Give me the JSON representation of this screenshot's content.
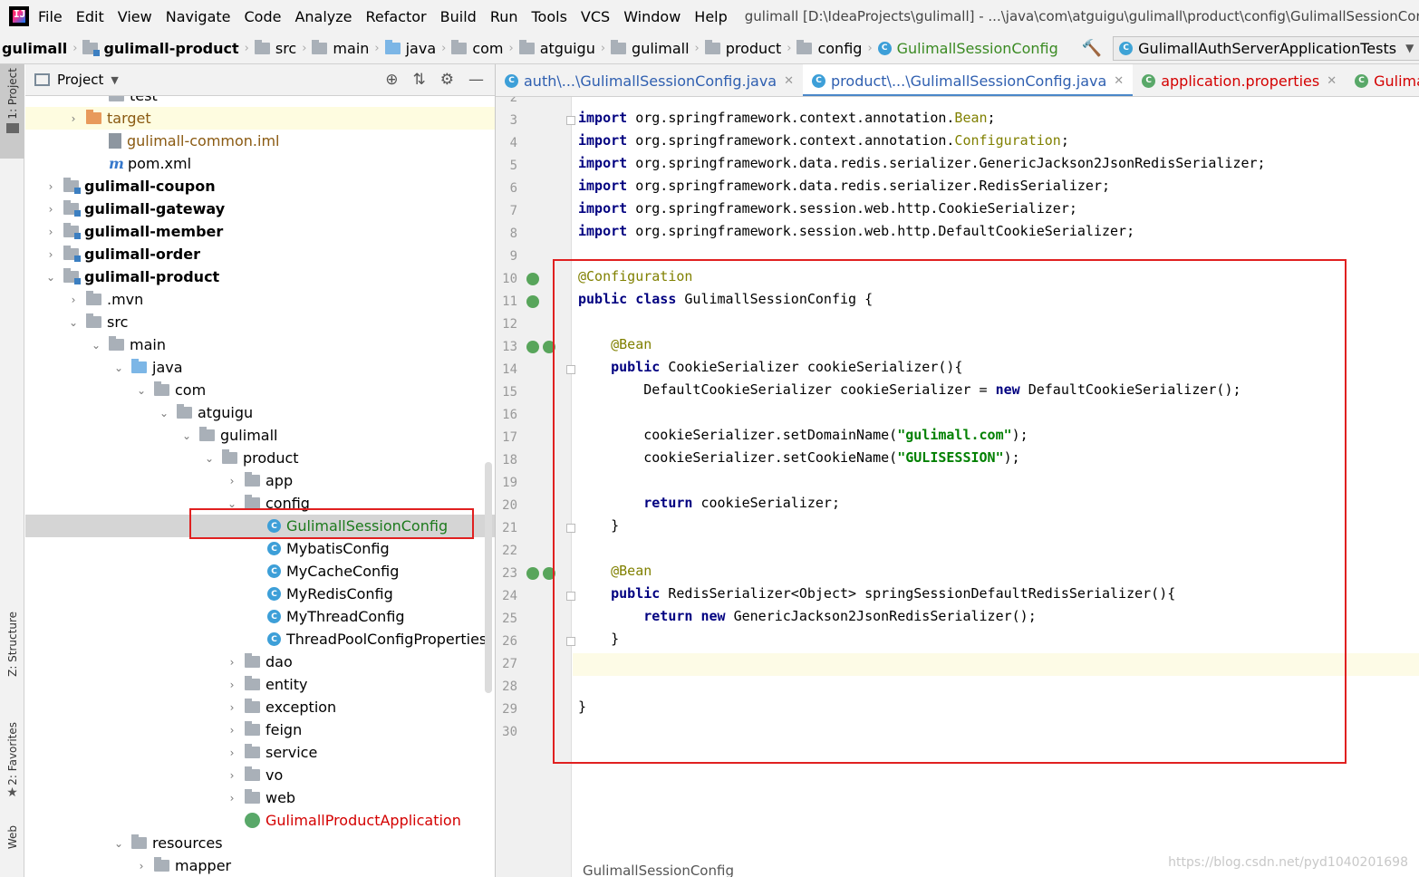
{
  "menubar": {
    "items": [
      "File",
      "Edit",
      "View",
      "Navigate",
      "Code",
      "Analyze",
      "Refactor",
      "Build",
      "Run",
      "Tools",
      "VCS",
      "Window",
      "Help"
    ],
    "window_title": "gulimall [D:\\IdeaProjects\\gulimall] - ...\\java\\com\\atguigu\\gulimall\\product\\config\\GulimallSessionConfig.java"
  },
  "breadcrumbs": [
    "gulimall",
    "gulimall-product",
    "src",
    "main",
    "java",
    "com",
    "atguigu",
    "gulimall",
    "product",
    "config",
    "GulimallSessionConfig"
  ],
  "run_config": "GulimallAuthServerApplicationTests",
  "left_strip": {
    "project": "1: Project",
    "structure": "Z: Structure",
    "favorites": "2: Favorites",
    "web": "Web"
  },
  "project_panel": {
    "title": "Project"
  },
  "tree": [
    {
      "label": "test",
      "indent": 3,
      "arrow": "",
      "icon": "folder",
      "style": ""
    },
    {
      "label": "target",
      "indent": 2,
      "arrow": "›",
      "icon": "folder-orange",
      "style": "brown",
      "highlight": true
    },
    {
      "label": "gulimall-common.iml",
      "indent": 3,
      "arrow": "",
      "icon": "file",
      "style": "brown"
    },
    {
      "label": "pom.xml",
      "indent": 3,
      "arrow": "",
      "icon": "maven",
      "style": ""
    },
    {
      "label": "gulimall-coupon",
      "indent": 1,
      "arrow": "›",
      "icon": "module",
      "style": "bold"
    },
    {
      "label": "gulimall-gateway",
      "indent": 1,
      "arrow": "›",
      "icon": "module",
      "style": "bold"
    },
    {
      "label": "gulimall-member",
      "indent": 1,
      "arrow": "›",
      "icon": "module",
      "style": "bold"
    },
    {
      "label": "gulimall-order",
      "indent": 1,
      "arrow": "›",
      "icon": "module",
      "style": "bold"
    },
    {
      "label": "gulimall-product",
      "indent": 1,
      "arrow": "⌄",
      "icon": "module",
      "style": "bold"
    },
    {
      "label": ".mvn",
      "indent": 2,
      "arrow": "›",
      "icon": "folder",
      "style": ""
    },
    {
      "label": "src",
      "indent": 2,
      "arrow": "⌄",
      "icon": "folder",
      "style": ""
    },
    {
      "label": "main",
      "indent": 3,
      "arrow": "⌄",
      "icon": "folder",
      "style": ""
    },
    {
      "label": "java",
      "indent": 4,
      "arrow": "⌄",
      "icon": "folder-blue",
      "style": ""
    },
    {
      "label": "com",
      "indent": 5,
      "arrow": "⌄",
      "icon": "folder",
      "style": ""
    },
    {
      "label": "atguigu",
      "indent": 6,
      "arrow": "⌄",
      "icon": "folder",
      "style": ""
    },
    {
      "label": "gulimall",
      "indent": 7,
      "arrow": "⌄",
      "icon": "folder",
      "style": ""
    },
    {
      "label": "product",
      "indent": 8,
      "arrow": "⌄",
      "icon": "folder",
      "style": ""
    },
    {
      "label": "app",
      "indent": 9,
      "arrow": "›",
      "icon": "folder",
      "style": ""
    },
    {
      "label": "config",
      "indent": 9,
      "arrow": "⌄",
      "icon": "folder",
      "style": ""
    },
    {
      "label": "GulimallSessionConfig",
      "indent": 10,
      "arrow": "",
      "icon": "class",
      "style": "green",
      "selected": true
    },
    {
      "label": "MybatisConfig",
      "indent": 10,
      "arrow": "",
      "icon": "class",
      "style": ""
    },
    {
      "label": "MyCacheConfig",
      "indent": 10,
      "arrow": "",
      "icon": "class",
      "style": ""
    },
    {
      "label": "MyRedisConfig",
      "indent": 10,
      "arrow": "",
      "icon": "class",
      "style": ""
    },
    {
      "label": "MyThreadConfig",
      "indent": 10,
      "arrow": "",
      "icon": "class",
      "style": ""
    },
    {
      "label": "ThreadPoolConfigProperties",
      "indent": 10,
      "arrow": "",
      "icon": "class",
      "style": ""
    },
    {
      "label": "dao",
      "indent": 9,
      "arrow": "›",
      "icon": "folder",
      "style": ""
    },
    {
      "label": "entity",
      "indent": 9,
      "arrow": "›",
      "icon": "folder",
      "style": ""
    },
    {
      "label": "exception",
      "indent": 9,
      "arrow": "›",
      "icon": "folder",
      "style": ""
    },
    {
      "label": "feign",
      "indent": 9,
      "arrow": "›",
      "icon": "folder",
      "style": ""
    },
    {
      "label": "service",
      "indent": 9,
      "arrow": "›",
      "icon": "folder",
      "style": ""
    },
    {
      "label": "vo",
      "indent": 9,
      "arrow": "›",
      "icon": "folder",
      "style": ""
    },
    {
      "label": "web",
      "indent": 9,
      "arrow": "›",
      "icon": "folder",
      "style": ""
    },
    {
      "label": "GulimallProductApplication",
      "indent": 9,
      "arrow": "",
      "icon": "spring",
      "style": "red"
    },
    {
      "label": "resources",
      "indent": 4,
      "arrow": "⌄",
      "icon": "folder-res",
      "style": ""
    },
    {
      "label": "mapper",
      "indent": 5,
      "arrow": "›",
      "icon": "folder",
      "style": ""
    }
  ],
  "tabs": [
    {
      "label": "auth\\...\\GulimallSessionConfig.java",
      "color": "blue",
      "active": false
    },
    {
      "label": "product\\...\\GulimallSessionConfig.java",
      "color": "blue",
      "active": true
    },
    {
      "label": "application.properties",
      "color": "red",
      "active": false
    },
    {
      "label": "GulimallProductApplica",
      "color": "red",
      "active": false
    }
  ],
  "code_lines": [
    {
      "n": "2",
      "html": ""
    },
    {
      "n": "3",
      "html": "<span class=\"kw\">import</span> org.springframework.context.annotation.<span class=\"ann\">Bean</span>;"
    },
    {
      "n": "4",
      "html": "<span class=\"kw\">import</span> org.springframework.context.annotation.<span class=\"ann\">Configuration</span>;"
    },
    {
      "n": "5",
      "html": "<span class=\"kw\">import</span> org.springframework.data.redis.serializer.GenericJackson2JsonRedisSerializer;"
    },
    {
      "n": "6",
      "html": "<span class=\"kw\">import</span> org.springframework.data.redis.serializer.RedisSerializer;"
    },
    {
      "n": "7",
      "html": "<span class=\"kw\">import</span> org.springframework.session.web.http.CookieSerializer;"
    },
    {
      "n": "8",
      "html": "<span class=\"kw\">import</span> org.springframework.session.web.http.DefaultCookieSerializer;"
    },
    {
      "n": "9",
      "html": ""
    },
    {
      "n": "10",
      "html": "<span class=\"ann\">@Configuration</span>"
    },
    {
      "n": "11",
      "html": "<span class=\"kw\">public class</span> GulimallSessionConfig {"
    },
    {
      "n": "12",
      "html": ""
    },
    {
      "n": "13",
      "html": "    <span class=\"ann\">@Bean</span>"
    },
    {
      "n": "14",
      "html": "    <span class=\"kw\">public</span> CookieSerializer cookieSerializer(){"
    },
    {
      "n": "15",
      "html": "        DefaultCookieSerializer cookieSerializer = <span class=\"kw\">new</span> DefaultCookieSerializer();"
    },
    {
      "n": "16",
      "html": ""
    },
    {
      "n": "17",
      "html": "        cookieSerializer.setDomainName(<span class=\"str\">\"gulimall.com\"</span>);"
    },
    {
      "n": "18",
      "html": "        cookieSerializer.setCookieName(<span class=\"str\">\"GULISESSION\"</span>);"
    },
    {
      "n": "19",
      "html": ""
    },
    {
      "n": "20",
      "html": "        <span class=\"kw\">return</span> cookieSerializer;"
    },
    {
      "n": "21",
      "html": "    }"
    },
    {
      "n": "22",
      "html": ""
    },
    {
      "n": "23",
      "html": "    <span class=\"ann\">@Bean</span>"
    },
    {
      "n": "24",
      "html": "    <span class=\"kw\">public</span> RedisSerializer&lt;Object&gt; springSessionDefaultRedisSerializer(){"
    },
    {
      "n": "25",
      "html": "        <span class=\"kw\">return new</span> GenericJackson2JsonRedisSerializer();"
    },
    {
      "n": "26",
      "html": "    }"
    },
    {
      "n": "27",
      "html": ""
    },
    {
      "n": "28",
      "html": ""
    },
    {
      "n": "29",
      "html": "}"
    },
    {
      "n": "30",
      "html": ""
    }
  ],
  "editor_footer": "GulimallSessionConfig",
  "watermark": "https://blog.csdn.net/pyd1040201698"
}
